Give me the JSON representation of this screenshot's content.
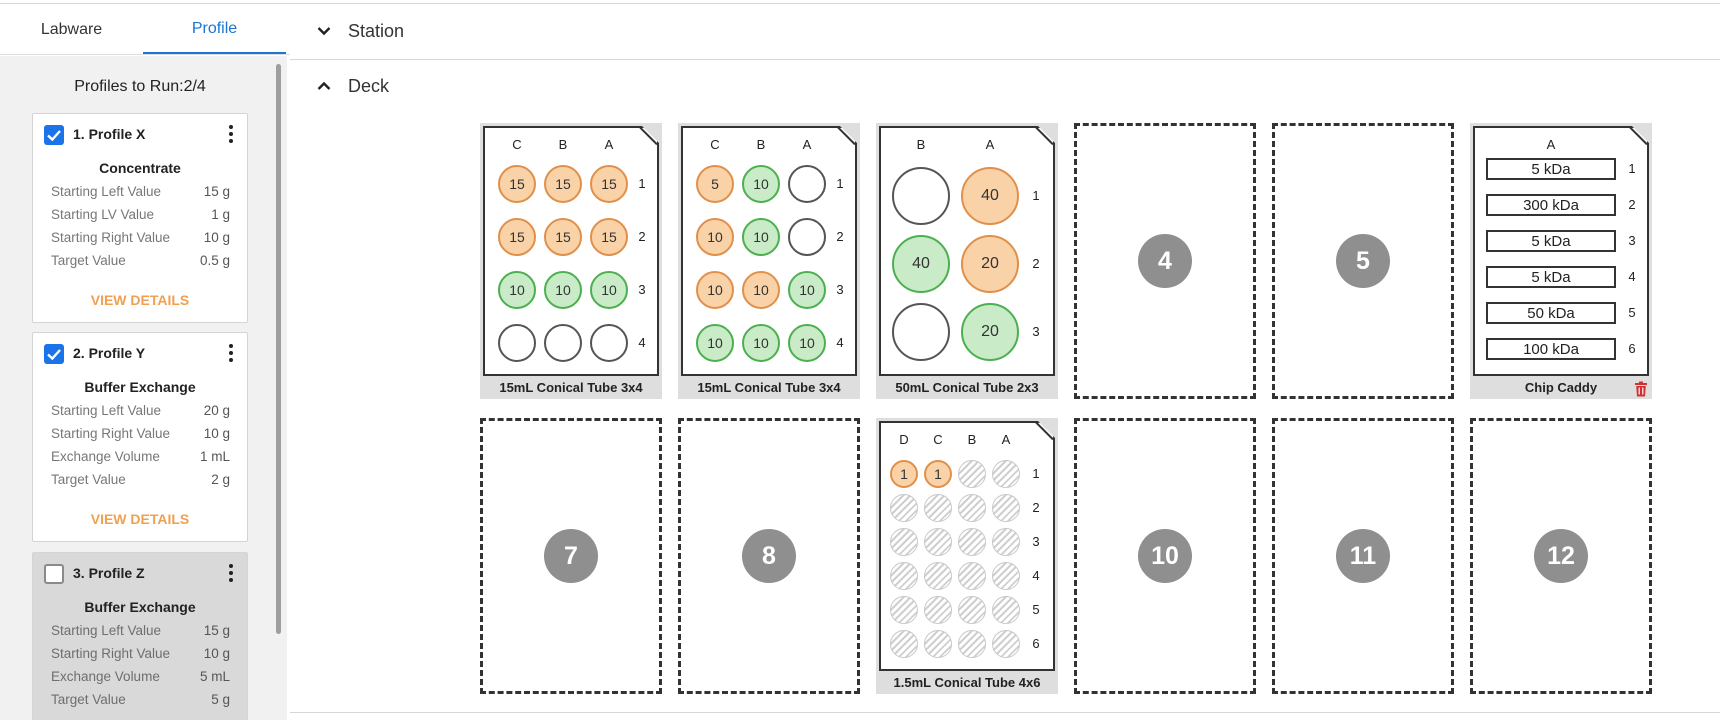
{
  "tabs": {
    "labware": "Labware",
    "profile": "Profile"
  },
  "sidebar": {
    "runs_label": "Profiles to Run:2/4",
    "profiles": [
      {
        "name": "1. Profile X",
        "checked": true,
        "type": "Concentrate",
        "rows": [
          {
            "label": "Starting Left Value",
            "value": "15 g"
          },
          {
            "label": "Starting LV Value",
            "value": "1 g"
          },
          {
            "label": "Starting Right Value",
            "value": "10 g"
          },
          {
            "label": "Target Value",
            "value": "0.5 g"
          }
        ],
        "details": "VIEW DETAILS"
      },
      {
        "name": "2. Profile Y",
        "checked": true,
        "type": "Buffer Exchange",
        "rows": [
          {
            "label": "Starting Left Value",
            "value": "20 g"
          },
          {
            "label": "Starting Right Value",
            "value": "10 g"
          },
          {
            "label": "Exchange Volume",
            "value": "1 mL"
          },
          {
            "label": "Target Value",
            "value": "2 g"
          }
        ],
        "details": "VIEW DETAILS"
      },
      {
        "name": "3. Profile Z",
        "checked": false,
        "type": "Buffer Exchange",
        "rows": [
          {
            "label": "Starting Left Value",
            "value": "15 g"
          },
          {
            "label": "Starting Right Value",
            "value": "10 g"
          },
          {
            "label": "Exchange Volume",
            "value": "5 mL"
          },
          {
            "label": "Target Value",
            "value": "5 g"
          }
        ]
      }
    ]
  },
  "sections": {
    "station": "Station",
    "deck": "Deck"
  },
  "colors": {
    "accent": "#1976d2",
    "orange": "#e0904a",
    "green": "#4caf50",
    "delete": "#d32f2f"
  },
  "deck": {
    "slot1": {
      "name": "15mL Conical Tube 3x4",
      "cols": [
        "C",
        "B",
        "A"
      ],
      "rows": [
        "1",
        "2",
        "3",
        "4"
      ],
      "wells": [
        [
          "o:15",
          "o:15",
          "o:15"
        ],
        [
          "o:15",
          "o:15",
          "o:15"
        ],
        [
          "g:10",
          "g:10",
          "g:10"
        ],
        [
          "e:",
          "e:",
          "e:"
        ]
      ]
    },
    "slot2": {
      "name": "15mL Conical Tube 3x4",
      "cols": [
        "C",
        "B",
        "A"
      ],
      "rows": [
        "1",
        "2",
        "3",
        "4"
      ],
      "wells": [
        [
          "o:5",
          "g:10",
          "e:"
        ],
        [
          "o:10",
          "g:10",
          "e:"
        ],
        [
          "o:10",
          "o:10",
          "g:10"
        ],
        [
          "g:10",
          "g:10",
          "g:10"
        ]
      ]
    },
    "slot3": {
      "name": "50mL Conical Tube 2x3",
      "cols": [
        "B",
        "A"
      ],
      "rows": [
        "1",
        "2",
        "3"
      ],
      "wells": [
        [
          "e:",
          "o:40"
        ],
        [
          "g:40",
          "o:20"
        ],
        [
          "e:",
          "g:20"
        ]
      ]
    },
    "slot6": {
      "name": "Chip Caddy",
      "col": "A",
      "rows": [
        "1",
        "2",
        "3",
        "4",
        "5",
        "6"
      ],
      "chips": [
        "5 kDa",
        "300 kDa",
        "5 kDa",
        "5 kDa",
        "50 kDa",
        "100 kDa"
      ]
    },
    "slot9": {
      "name": "1.5mL Conical Tube 4x6",
      "cols": [
        "D",
        "C",
        "B",
        "A"
      ],
      "rows": [
        "1",
        "2",
        "3",
        "4",
        "5",
        "6"
      ],
      "wells": [
        [
          "o:1",
          "o:1",
          "h:",
          "h:"
        ],
        [
          "h:",
          "h:",
          "h:",
          "h:"
        ],
        [
          "h:",
          "h:",
          "h:",
          "h:"
        ],
        [
          "h:",
          "h:",
          "h:",
          "h:"
        ],
        [
          "h:",
          "h:",
          "h:",
          "h:"
        ],
        [
          "h:",
          "h:",
          "h:",
          "h:"
        ]
      ]
    },
    "empty_slots": [
      "4",
      "5",
      "7",
      "8",
      "10",
      "11",
      "12"
    ]
  }
}
